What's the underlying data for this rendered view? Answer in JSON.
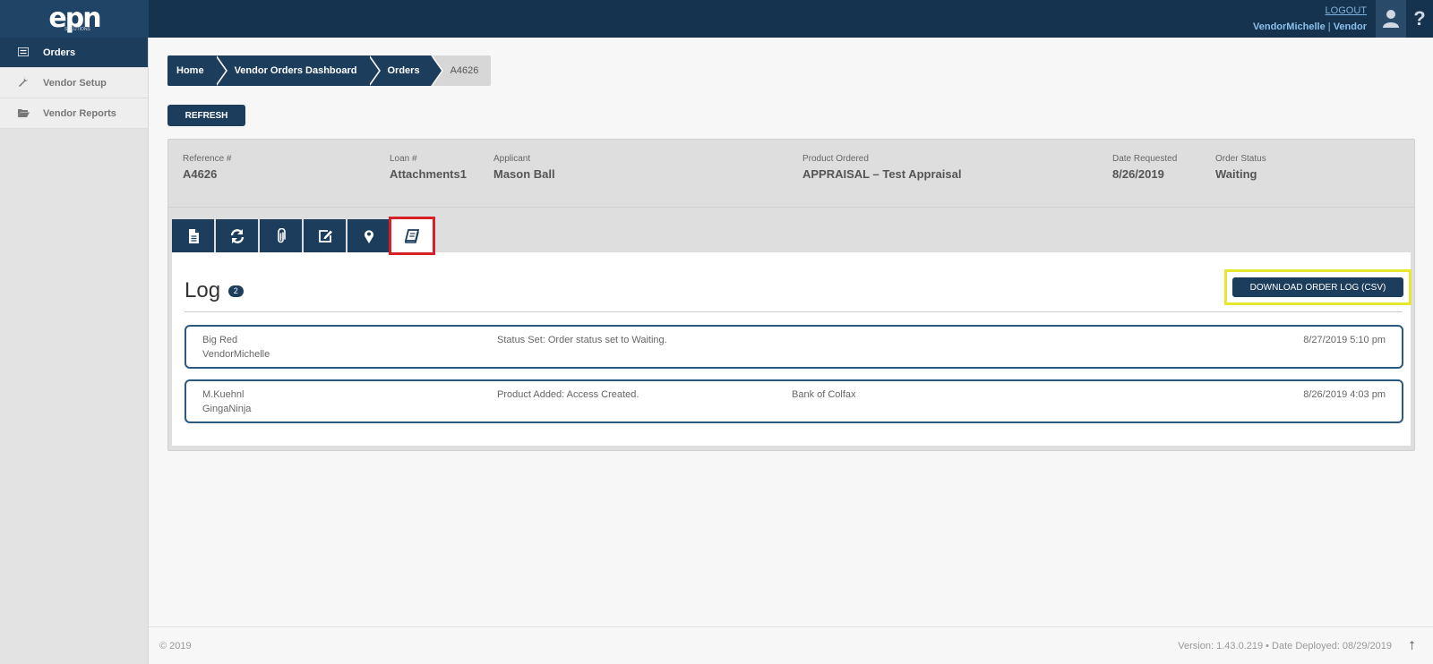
{
  "app": {
    "logo_text": "epn",
    "logo_sub": "SOLUTIONS"
  },
  "header": {
    "logout_label": "LOGOUT",
    "username": "VendorMichelle",
    "separator": "|",
    "role": "Vendor",
    "help_label": "?"
  },
  "sidebar": {
    "items": [
      {
        "label": "Orders",
        "icon": "list-icon",
        "active": true
      },
      {
        "label": "Vendor Setup",
        "icon": "wrench-icon",
        "active": false
      },
      {
        "label": "Vendor Reports",
        "icon": "folder-icon",
        "active": false
      }
    ]
  },
  "breadcrumb": [
    "Home",
    "Vendor Orders Dashboard",
    "Orders",
    "A4626"
  ],
  "toolbar": {
    "refresh_label": "REFRESH"
  },
  "order": {
    "reference_label": "Reference #",
    "reference_value": "A4626",
    "loan_label": "Loan #",
    "loan_value": "Attachments1",
    "applicant_label": "Applicant",
    "applicant_value": "Mason Ball",
    "product_label": "Product Ordered",
    "product_value": "APPRAISAL – Test Appraisal",
    "date_label": "Date Requested",
    "date_value": "8/26/2019",
    "status_label": "Order Status",
    "status_value": "Waiting"
  },
  "tabs": [
    {
      "icon": "document-icon"
    },
    {
      "icon": "refresh-icon"
    },
    {
      "icon": "paperclip-icon"
    },
    {
      "icon": "edit-icon"
    },
    {
      "icon": "map-pin-icon"
    },
    {
      "icon": "book-icon",
      "active": true
    }
  ],
  "log": {
    "title": "Log",
    "count": "2",
    "download_label": "DOWNLOAD ORDER LOG (CSV)",
    "entries": [
      {
        "user": "Big Red",
        "account": "VendorMichelle",
        "message": "Status Set: Order status set to Waiting.",
        "extra": "",
        "timestamp": "8/27/2019 5:10 pm"
      },
      {
        "user": "M.Kuehnl",
        "account": "GingaNinja",
        "message": "Product Added: Access Created.",
        "extra": "Bank of Colfax",
        "timestamp": "8/26/2019 4:03 pm"
      }
    ]
  },
  "footer": {
    "copyright": "© 2019",
    "version": "Version: 1.43.0.219  •  Date Deployed: 08/29/2019",
    "scroll_top": "⭡"
  },
  "colors": {
    "navy": "#1c3d5c",
    "topbar": "#15334f",
    "highlight_red": "#d61f26",
    "highlight_yellow": "#e7e72d"
  }
}
